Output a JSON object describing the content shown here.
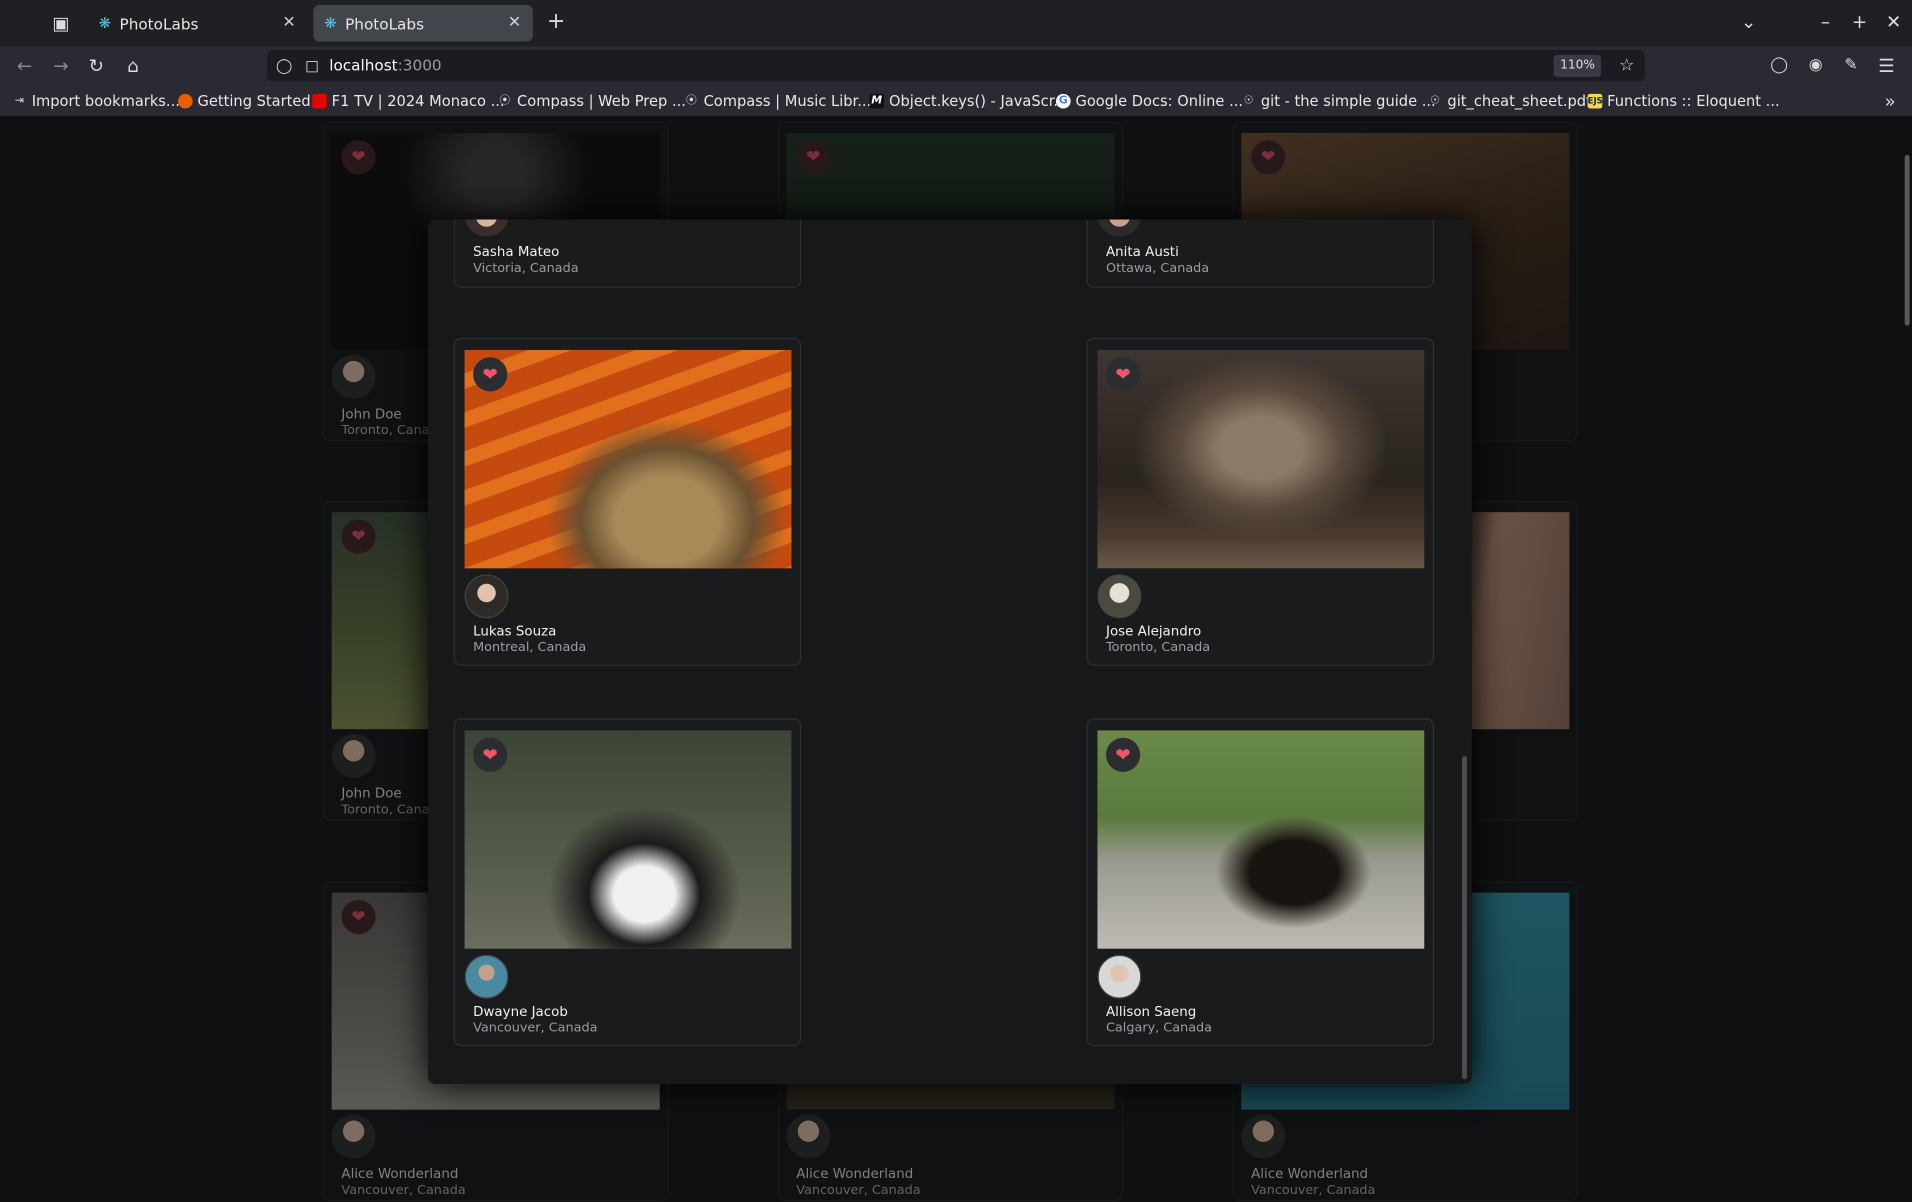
{
  "browser": {
    "tabs": [
      {
        "label": "PhotoLabs",
        "active": false
      },
      {
        "label": "PhotoLabs",
        "active": true
      }
    ],
    "new_tab": "+",
    "url_host": "localhost",
    "url_port": ":3000",
    "zoom": "110%",
    "bookmarks": [
      "Import bookmarks...",
      "Getting Started",
      "F1 TV | 2024 Monaco ...",
      "Compass | Web Prep ...",
      "Compass | Music Libr...",
      "Object.keys() - JavaScr...",
      "Google Docs: Online ...",
      "git - the simple guide ...",
      "git_cheat_sheet.pdf",
      "Functions :: Eloquent ..."
    ]
  },
  "background_cards": [
    {
      "name": "John Doe",
      "location": "Toronto, Canada"
    },
    {
      "name": "John Doe",
      "location": "Toronto, Canada"
    },
    {
      "name": "Alice Wonderland",
      "location": "Vancouver, Canada"
    },
    {
      "name": "Alice Wonderland",
      "location": "Vancouver, Canada"
    },
    {
      "name": "Alice Wonderland",
      "location": "Vancouver, Canada"
    }
  ],
  "modal": {
    "top_cards": [
      {
        "name": "Sasha Mateo",
        "location": "Victoria, Canada"
      },
      {
        "name": "Anita Austi",
        "location": "Ottawa, Canada"
      }
    ],
    "cards": [
      {
        "name": "Lukas Souza",
        "location": "Montreal, Canada"
      },
      {
        "name": "Jose Alejandro",
        "location": "Toronto, Canada"
      },
      {
        "name": "Dwayne Jacob",
        "location": "Vancouver, Canada"
      },
      {
        "name": "Allison Saeng",
        "location": "Calgary, Canada"
      }
    ]
  },
  "icons": {
    "heart": "heart-icon",
    "react": "react-logo-icon"
  },
  "colors": {
    "heart": "#f05569",
    "tab_active": "#42454b",
    "page_bg": "#0f1011",
    "modal_bg": "#17181a"
  }
}
